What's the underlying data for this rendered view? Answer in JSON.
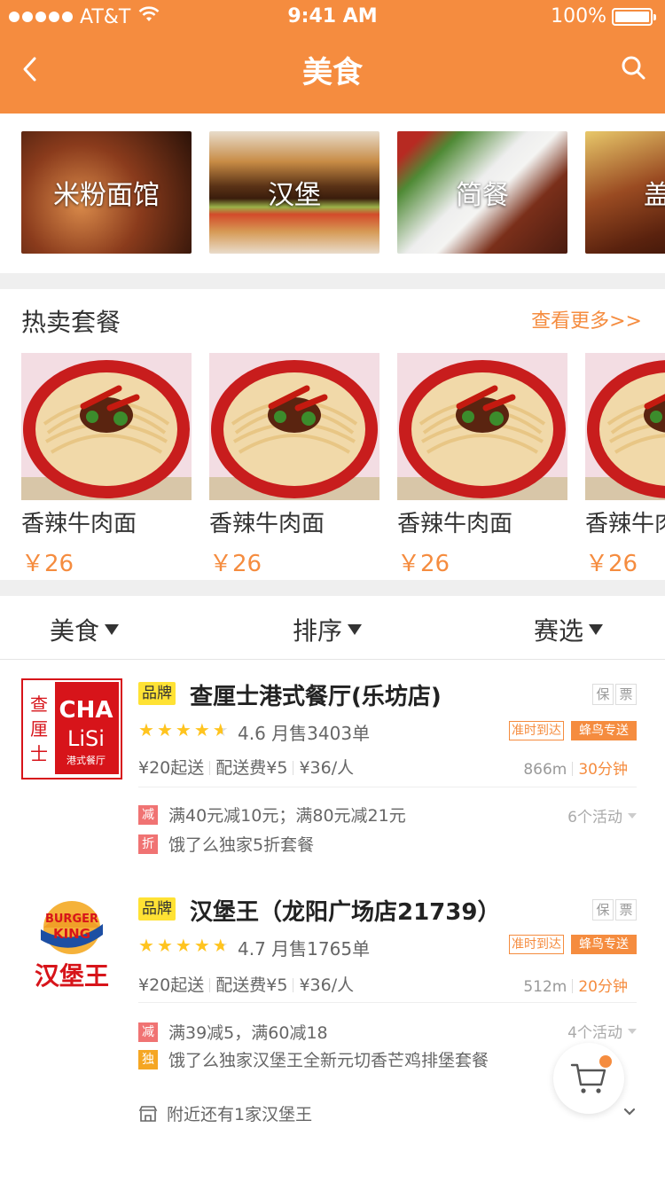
{
  "status_bar": {
    "carrier": "AT&T",
    "time": "9:41 AM",
    "battery": "100%"
  },
  "nav": {
    "title": "美食"
  },
  "categories": [
    {
      "label": "米粉面馆"
    },
    {
      "label": "汉堡"
    },
    {
      "label": "简餐"
    },
    {
      "label": "盖浇"
    }
  ],
  "hot": {
    "title": "热卖套餐",
    "more": "查看更多>>",
    "items": [
      {
        "name": "香辣牛肉面",
        "price": "￥26"
      },
      {
        "name": "香辣牛肉面",
        "price": "￥26"
      },
      {
        "name": "香辣牛肉面",
        "price": "￥26"
      },
      {
        "name": "香辣牛肉面",
        "price": "￥26"
      }
    ]
  },
  "filters": {
    "food": "美食",
    "sort": "排序",
    "select": "赛选"
  },
  "shops": [
    {
      "brand": "品牌",
      "name": "查厘士港式餐厅(乐坊店)",
      "tag_bao": "保",
      "tag_piao": "票",
      "stars": 4.6,
      "rating": "4.6",
      "monthly": "月售3403单",
      "tag_ontime": "准时到达",
      "tag_fengniao": "蜂鸟专送",
      "min_order": "¥20起送",
      "fee": "配送费¥5",
      "per_person": "¥36/人",
      "distance": "866m",
      "time": "30分钟",
      "logo": {
        "cn": "查厘士",
        "en1": "CHA",
        "en2": "LiSi",
        "sub": "港式餐厅"
      },
      "promos": [
        {
          "mark": "减",
          "color": "#f07373",
          "text": "满40元减10元；满80元减21元"
        },
        {
          "mark": "折",
          "color": "#f07373",
          "text": "饿了么独家5折套餐"
        }
      ],
      "activities": "6个活动"
    },
    {
      "brand": "品牌",
      "name": "汉堡王（龙阳广场店21739）",
      "tag_bao": "保",
      "tag_piao": "票",
      "stars": 4.7,
      "rating": "4.7",
      "monthly": "月售1765单",
      "tag_ontime": "准时到达",
      "tag_fengniao": "蜂鸟专送",
      "min_order": "¥20起送",
      "fee": "配送费¥5",
      "per_person": "¥36/人",
      "distance": "512m",
      "time": "20分钟",
      "logo": {
        "line1": "BURGER",
        "line2": "KING",
        "cn": "汉堡王"
      },
      "promos": [
        {
          "mark": "减",
          "color": "#f07373",
          "text": "满39减5，满60减18"
        },
        {
          "mark": "独",
          "color": "#f5a623",
          "text": "饿了么独家汉堡王全新元切香芒鸡排堡套餐"
        }
      ],
      "activities": "4个活动",
      "nearby": "附近还有1家汉堡王"
    }
  ]
}
